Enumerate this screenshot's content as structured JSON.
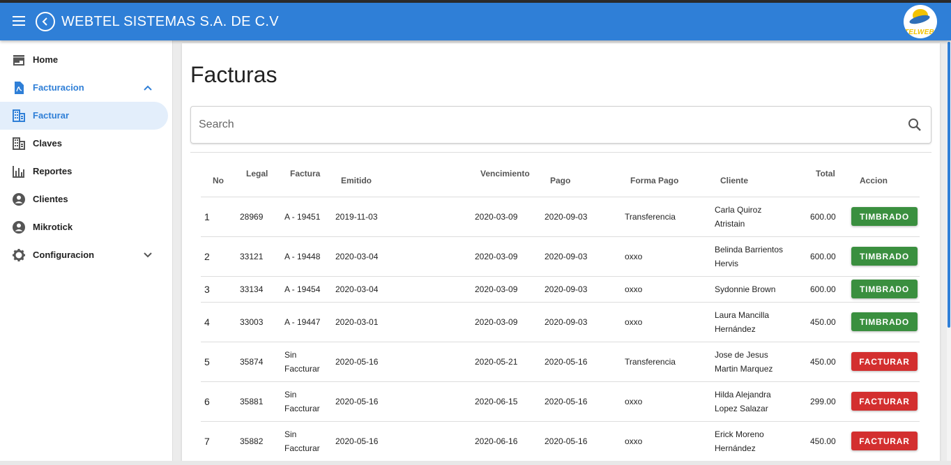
{
  "appbar": {
    "title": "WEBTEL SISTEMAS S.A. DE C.V",
    "logo_text": "TELWEB"
  },
  "sidebar": {
    "items": [
      {
        "label": "Home",
        "icon": "store-icon"
      },
      {
        "label": "Facturacion",
        "icon": "pdf-icon",
        "expanded": true
      },
      {
        "label": "Facturar",
        "icon": "building-icon",
        "active": true
      },
      {
        "label": "Claves",
        "icon": "building-icon"
      },
      {
        "label": "Reportes",
        "icon": "chart-icon"
      },
      {
        "label": "Clientes",
        "icon": "account-circle-icon"
      },
      {
        "label": "Mikrotick",
        "icon": "account-circle-icon"
      },
      {
        "label": "Configuracion",
        "icon": "gear-icon",
        "expanded": false
      }
    ]
  },
  "main": {
    "title": "Facturas",
    "search": {
      "placeholder": "Search",
      "value": ""
    },
    "table": {
      "headers": {
        "no": "No",
        "legal": "Legal",
        "factura": "Factura",
        "emitido": "Emitido",
        "vencimiento": "Vencimiento",
        "pago": "Pago",
        "forma_pago": "Forma Pago",
        "cliente": "Cliente",
        "total": "Total",
        "accion": "Accion"
      },
      "rows": [
        {
          "no": "1",
          "legal": "28969",
          "factura": [
            "A - 19451"
          ],
          "emitido": "2019-11-03",
          "vencimiento": "2020-03-09",
          "pago": "2020-09-03",
          "forma_pago": "Transferencia",
          "cliente": [
            "Carla Quiroz",
            "Atristain"
          ],
          "total": "600.00",
          "accion": "TIMBRADO",
          "status": "timbrado"
        },
        {
          "no": "2",
          "legal": "33121",
          "factura": [
            "A - 19448"
          ],
          "emitido": "2020-03-04",
          "vencimiento": "2020-03-09",
          "pago": "2020-09-03",
          "forma_pago": "oxxo",
          "cliente": [
            "Belinda Barrientos",
            "Hervis"
          ],
          "total": "600.00",
          "accion": "TIMBRADO",
          "status": "timbrado"
        },
        {
          "no": "3",
          "legal": "33134",
          "factura": [
            "A - 19454"
          ],
          "emitido": "2020-03-04",
          "vencimiento": "2020-03-09",
          "pago": "2020-09-03",
          "forma_pago": "oxxo",
          "cliente": [
            "Sydonnie Brown"
          ],
          "total": "600.00",
          "accion": "TIMBRADO",
          "status": "timbrado"
        },
        {
          "no": "4",
          "legal": "33003",
          "factura": [
            "A - 19447"
          ],
          "emitido": "2020-03-01",
          "vencimiento": "2020-03-09",
          "pago": "2020-09-03",
          "forma_pago": "oxxo",
          "cliente": [
            "Laura Mancilla",
            "Hernández"
          ],
          "total": "450.00",
          "accion": "TIMBRADO",
          "status": "timbrado"
        },
        {
          "no": "5",
          "legal": "35874",
          "factura": [
            "Sin",
            "Faccturar"
          ],
          "emitido": "2020-05-16",
          "vencimiento": "2020-05-21",
          "pago": "2020-05-16",
          "forma_pago": "Transferencia",
          "cliente": [
            "Jose de Jesus",
            "Martin Marquez"
          ],
          "total": "450.00",
          "accion": "FACTURAR",
          "status": "facturar"
        },
        {
          "no": "6",
          "legal": "35881",
          "factura": [
            "Sin",
            "Faccturar"
          ],
          "emitido": "2020-05-16",
          "vencimiento": "2020-06-15",
          "pago": "2020-05-16",
          "forma_pago": "oxxo",
          "cliente": [
            "Hilda Alejandra",
            "Lopez Salazar"
          ],
          "total": "299.00",
          "accion": "FACTURAR",
          "status": "facturar"
        },
        {
          "no": "7",
          "legal": "35882",
          "factura": [
            "Sin",
            "Faccturar"
          ],
          "emitido": "2020-05-16",
          "vencimiento": "2020-06-16",
          "pago": "2020-05-16",
          "forma_pago": "oxxo",
          "cliente": [
            "Erick Moreno",
            "Hernández"
          ],
          "total": "450.00",
          "accion": "FACTURAR",
          "status": "facturar"
        }
      ]
    }
  },
  "colors": {
    "primary": "#2f7fd7",
    "timbrado": "#3a8f3f",
    "facturar": "#d32f2f"
  }
}
